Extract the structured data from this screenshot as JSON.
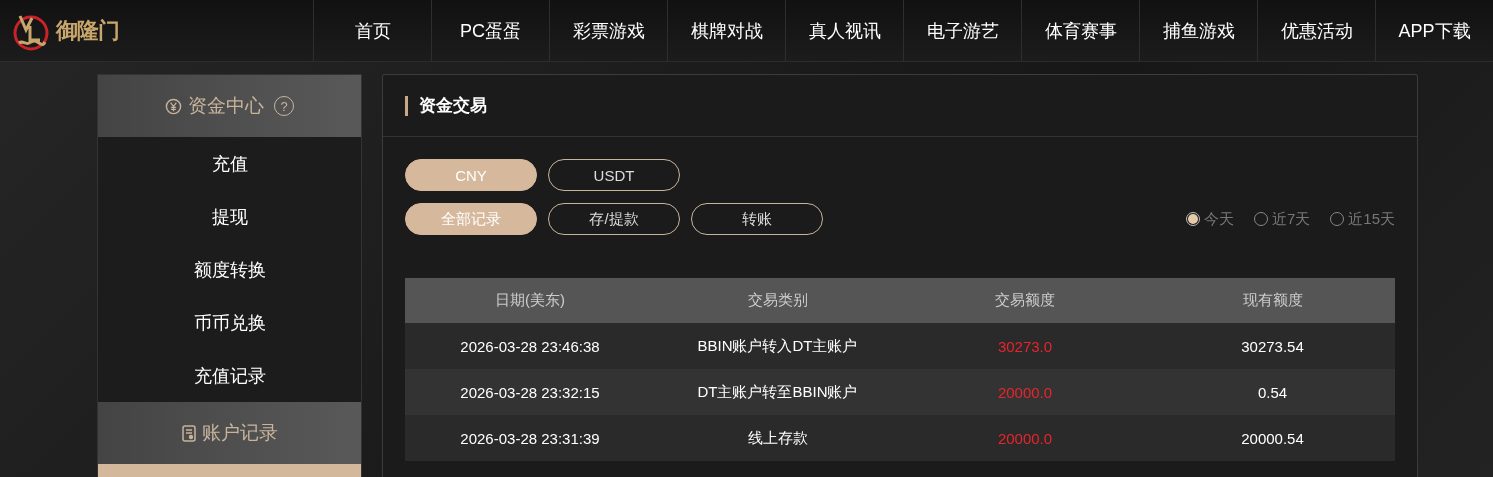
{
  "logo": {
    "text": "御隆门"
  },
  "nav": [
    {
      "label": "首页"
    },
    {
      "label": "PC蛋蛋"
    },
    {
      "label": "彩票游戏"
    },
    {
      "label": "棋牌对战"
    },
    {
      "label": "真人视讯"
    },
    {
      "label": "电子游艺"
    },
    {
      "label": "体育赛事"
    },
    {
      "label": "捕鱼游戏"
    },
    {
      "label": "优惠活动"
    },
    {
      "label": "APP下载"
    }
  ],
  "sidebar": {
    "groups": [
      {
        "title": "资金中心",
        "kind": "yen",
        "help": "?",
        "items": [
          {
            "label": "充值",
            "selected": false
          },
          {
            "label": "提现",
            "selected": false
          },
          {
            "label": "额度转换",
            "selected": false
          },
          {
            "label": "币币兑换",
            "selected": false
          },
          {
            "label": "充值记录",
            "selected": false
          }
        ]
      },
      {
        "title": "账户记录",
        "kind": "record",
        "items": [
          {
            "selected": true
          }
        ]
      }
    ]
  },
  "panel": {
    "title": "资金交易",
    "currencies": [
      {
        "label": "CNY",
        "selected": true
      },
      {
        "label": "USDT",
        "selected": false
      }
    ],
    "filters": [
      {
        "label": "全部记录",
        "selected": true
      },
      {
        "label": "存/提款",
        "selected": false
      },
      {
        "label": "转账",
        "selected": false
      }
    ],
    "periods": [
      {
        "label": "今天",
        "selected": true
      },
      {
        "label": "近7天",
        "selected": false
      },
      {
        "label": "近15天",
        "selected": false
      }
    ],
    "table": {
      "columns": [
        "日期(美东)",
        "交易类别",
        "交易额度",
        "现有额度"
      ],
      "rows": [
        [
          "2026-03-28 23:46:38",
          "BBIN账户转入DT主账户",
          "30273.0",
          "30273.54"
        ],
        [
          "2026-03-28 23:32:15",
          "DT主账户转至BBIN账户",
          "20000.0",
          "0.54"
        ],
        [
          "2026-03-28 23:31:39",
          "线上存款",
          "20000.0",
          "20000.54"
        ]
      ]
    }
  }
}
